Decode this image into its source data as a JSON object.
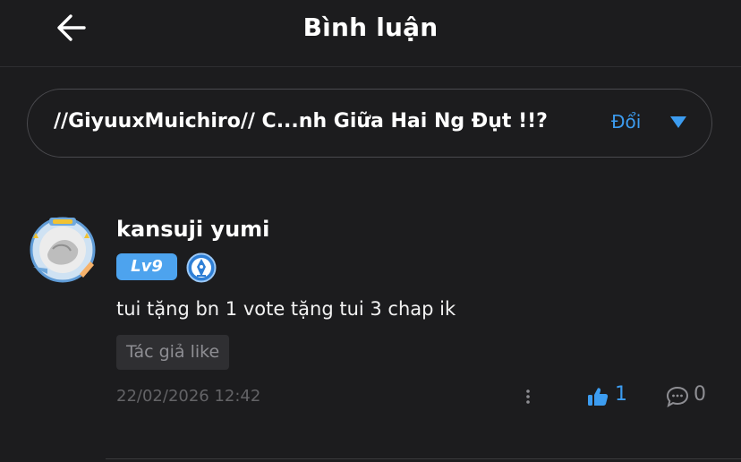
{
  "header": {
    "title": "Bình luận",
    "back_icon": "arrow-left-icon"
  },
  "chapter_selector": {
    "title": "//GiyuuxMuichiro// C...nh Giữa Hai Ng Đụt !!?",
    "change_label": "Đổi",
    "caret_icon": "caret-down-icon",
    "accent": "#3c9cf0"
  },
  "comment": {
    "username": "kansuji yumi",
    "level": "Lv9",
    "badge_icon": "pen-badge-icon",
    "text": "tui tặng bn 1 vote tặng tui 3 chap ik",
    "tag": "Tác giả like",
    "timestamp": "22/02/2026 12:42",
    "likes": "1",
    "replies": "0"
  },
  "colors": {
    "background": "#1c1c1e",
    "accent": "#3c9cf0",
    "muted": "#8e8e93"
  }
}
